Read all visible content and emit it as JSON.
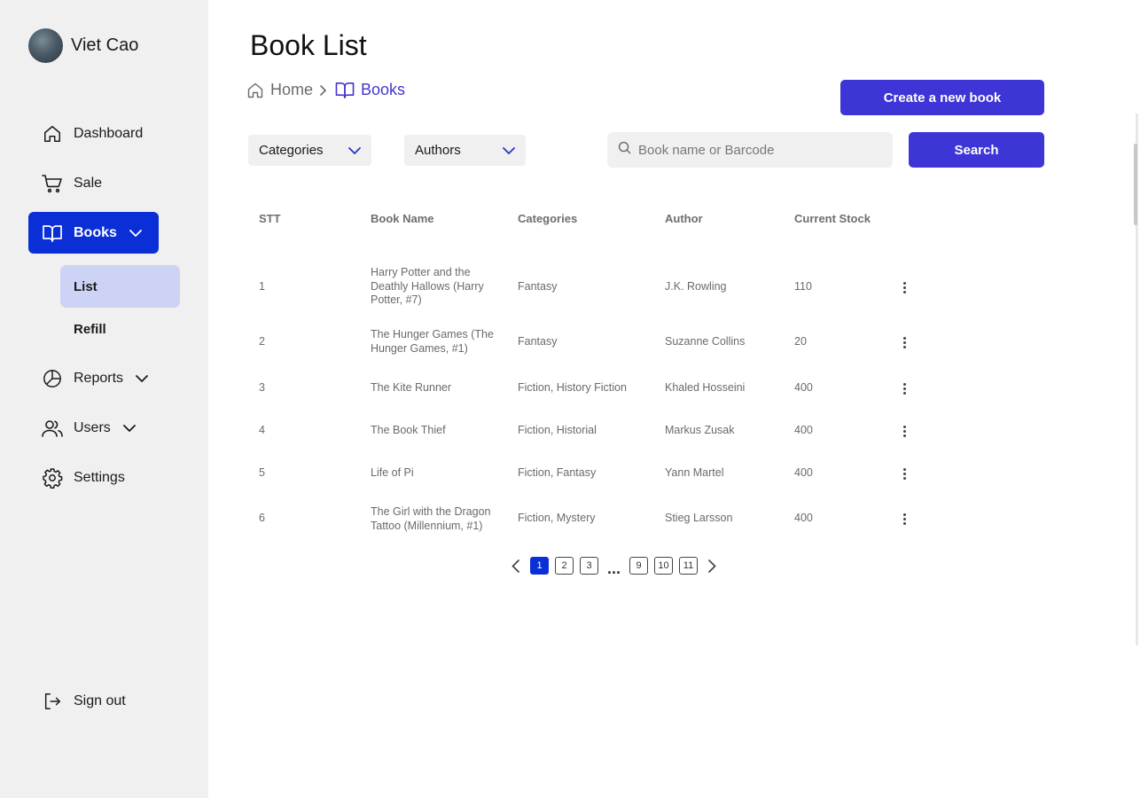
{
  "profile": {
    "name": "Viet Cao"
  },
  "sidebar": {
    "items": [
      {
        "label": "Dashboard"
      },
      {
        "label": "Sale"
      },
      {
        "label": "Books"
      },
      {
        "label": "Reports"
      },
      {
        "label": "Users"
      },
      {
        "label": "Settings"
      }
    ],
    "books_submenu": [
      {
        "label": "List",
        "active": true
      },
      {
        "label": "Refill",
        "active": false
      }
    ],
    "sign_out": "Sign out"
  },
  "header": {
    "title": "Book List",
    "breadcrumb": {
      "home": "Home",
      "current": "Books"
    },
    "create_button": "Create a new book"
  },
  "filters": {
    "categories": "Categories",
    "authors": "Authors",
    "search_placeholder": "Book name or Barcode",
    "search_button": "Search"
  },
  "table": {
    "headers": [
      "STT",
      "Book Name",
      "Categories",
      "Author",
      "Current Stock"
    ],
    "rows": [
      {
        "stt": "1",
        "name": "Harry Potter and the Deathly Hallows (Harry Potter, #7)",
        "categories": "Fantasy",
        "author": "J.K. Rowling",
        "stock": "110"
      },
      {
        "stt": "2",
        "name": "The Hunger Games (The Hunger Games, #1)",
        "categories": "Fantasy",
        "author": "Suzanne Collins",
        "stock": "20"
      },
      {
        "stt": "3",
        "name": "The Kite Runner",
        "categories": "Fiction, History Fiction",
        "author": "Khaled Hosseini",
        "stock": "400"
      },
      {
        "stt": "4",
        "name": "The Book Thief",
        "categories": "Fiction, Historial",
        "author": "Markus Zusak",
        "stock": "400"
      },
      {
        "stt": "5",
        "name": "Life of Pi",
        "categories": "Fiction, Fantasy",
        "author": "Yann Martel",
        "stock": "400"
      },
      {
        "stt": "6",
        "name": "The Girl with the Dragon Tattoo (Millennium, #1)",
        "categories": "Fiction, Mystery",
        "author": "Stieg Larsson",
        "stock": "400"
      }
    ]
  },
  "pagination": {
    "pages": [
      "1",
      "2",
      "3",
      "9",
      "10",
      "11"
    ],
    "current": "1",
    "ellipsis": "..."
  },
  "colors": {
    "accent": "#0b2fd6",
    "button": "#3e35d6",
    "submenu_active": "#cdd3f5",
    "sidebar_bg": "#f0f0f0"
  },
  "icons": [
    "home-icon",
    "cart-icon",
    "book-open-icon",
    "pie-chart-icon",
    "users-icon",
    "gear-icon",
    "sign-out-icon",
    "search-icon",
    "chevron-down-icon",
    "kebab-icon"
  ]
}
